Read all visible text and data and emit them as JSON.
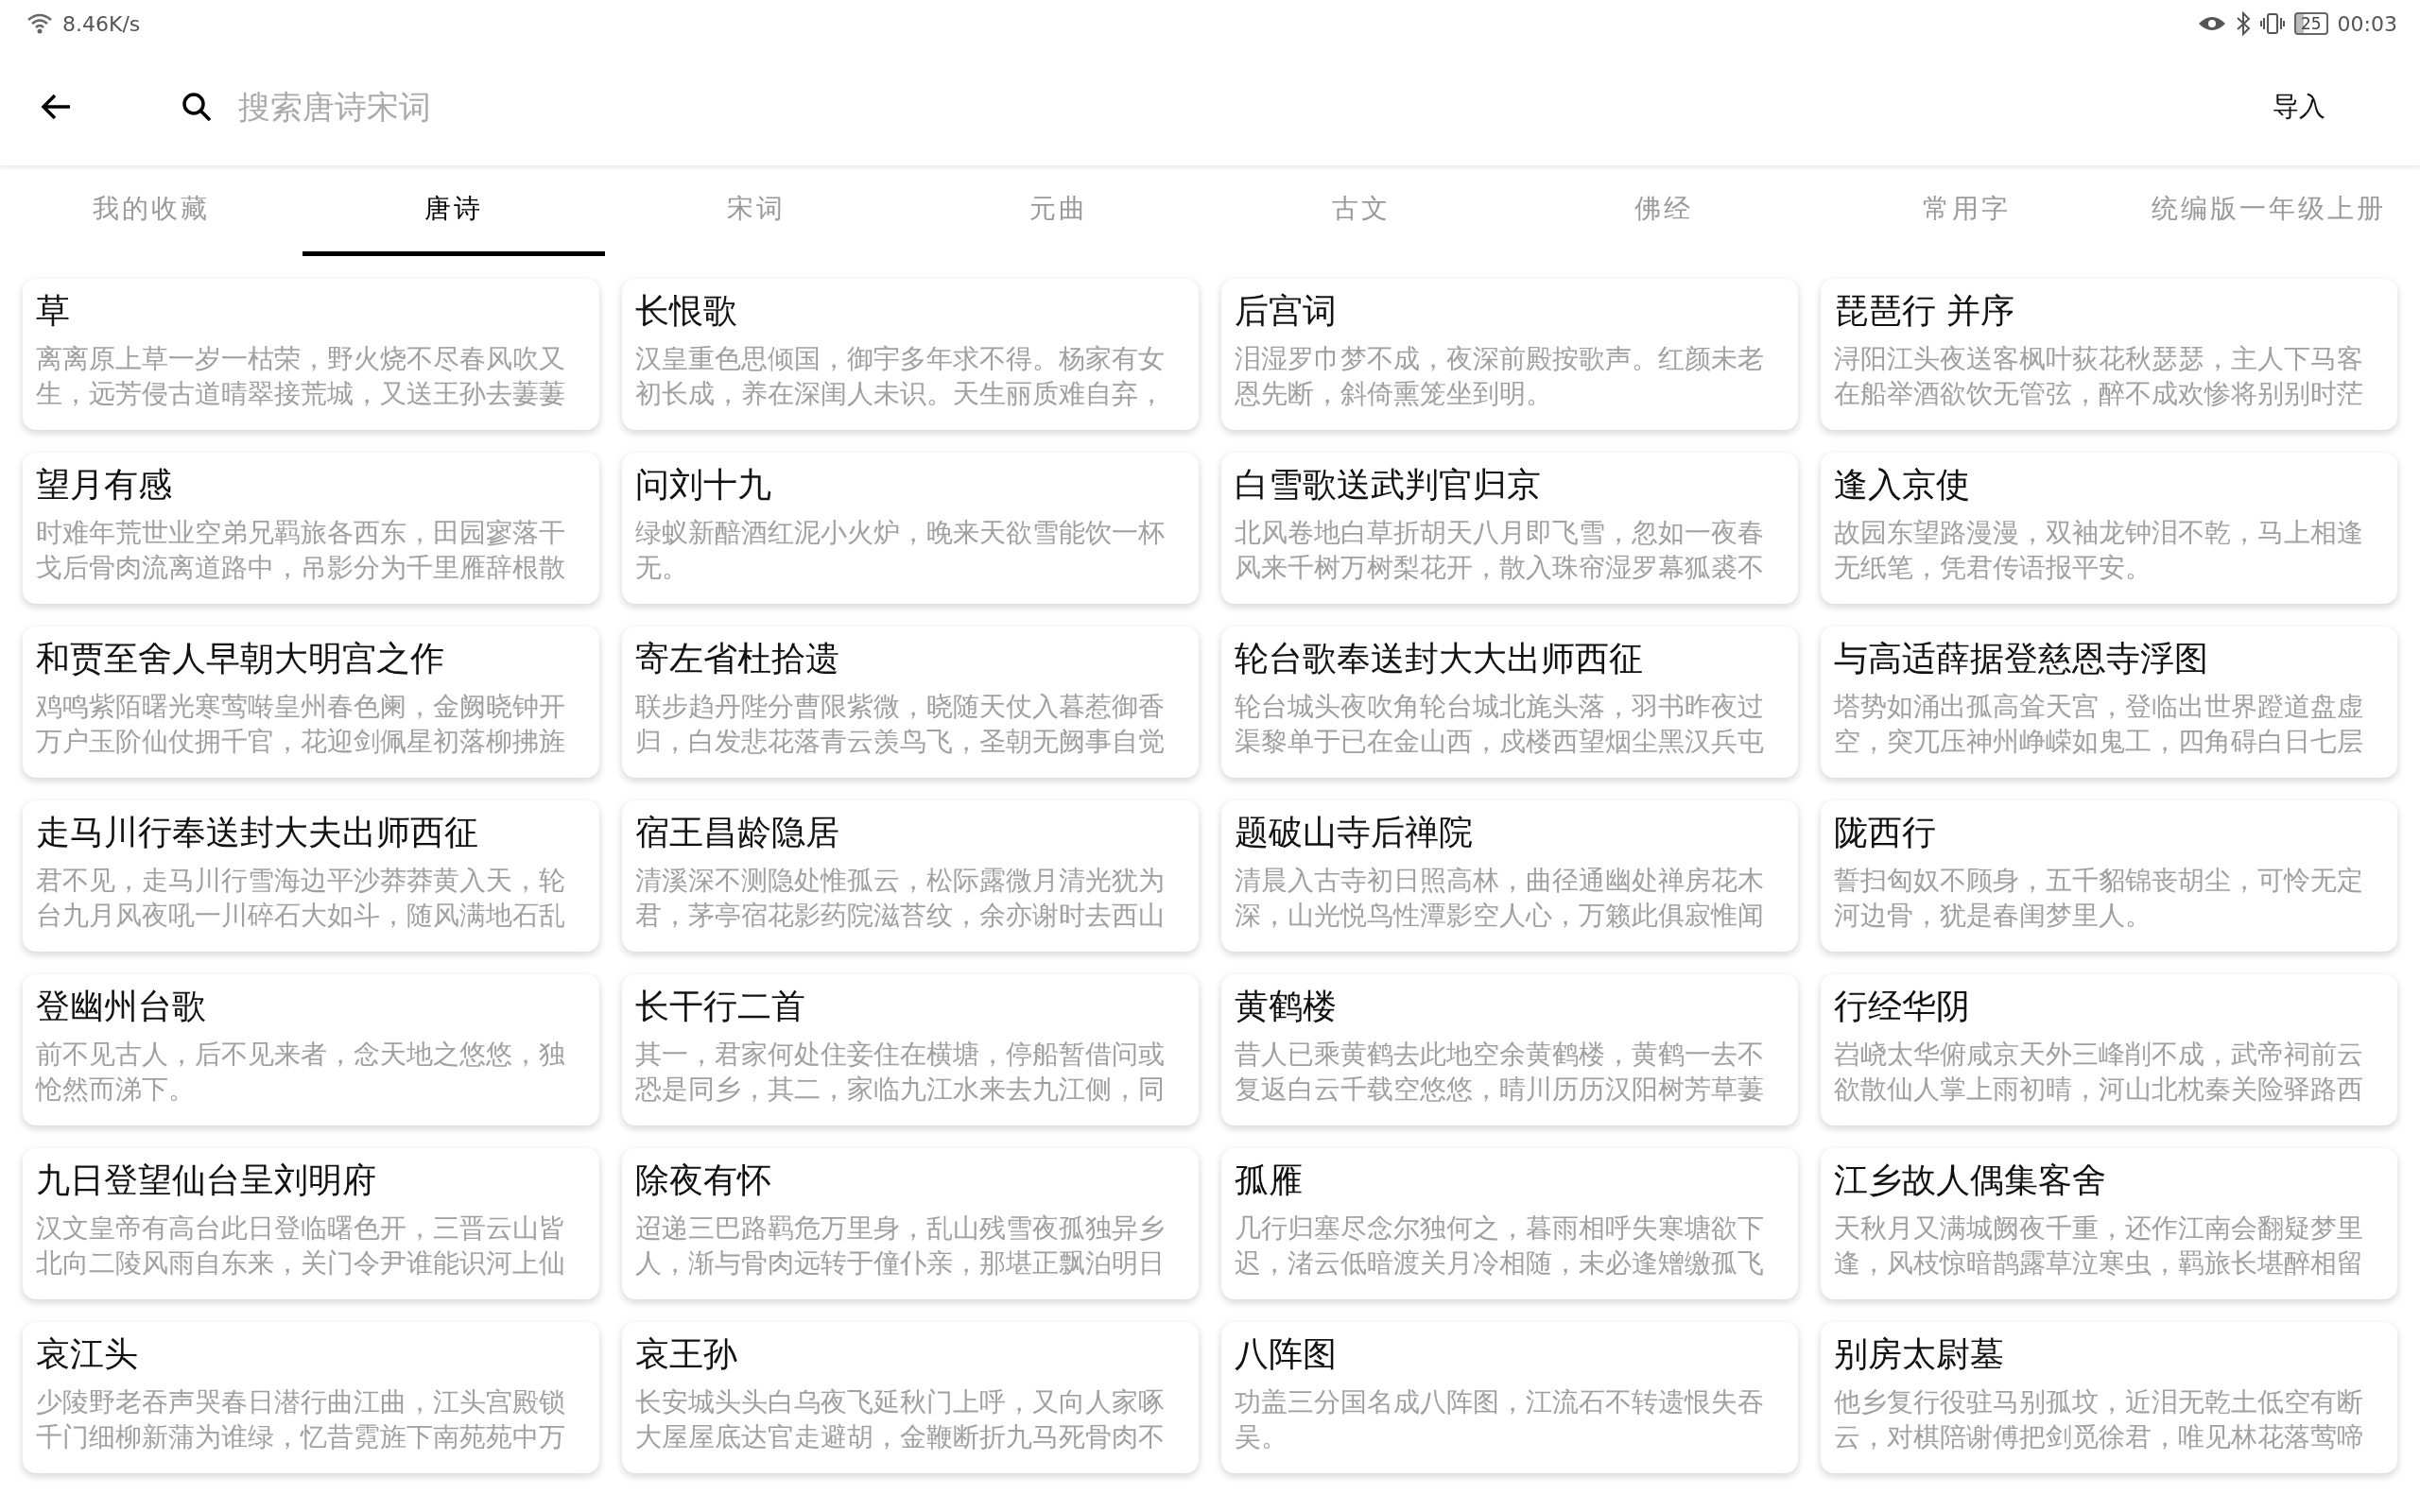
{
  "status_bar": {
    "speed": "8.46K/s",
    "battery": "25",
    "time": "00:03"
  },
  "header": {
    "search": {
      "placeholder": "搜索唐诗宋词"
    },
    "action": "导入"
  },
  "tabs": [
    {
      "label": "我的收藏",
      "selected": false
    },
    {
      "label": "唐诗",
      "selected": true
    },
    {
      "label": "宋词",
      "selected": false
    },
    {
      "label": "元曲",
      "selected": false
    },
    {
      "label": "古文",
      "selected": false
    },
    {
      "label": "佛经",
      "selected": false
    },
    {
      "label": "常用字",
      "selected": false
    },
    {
      "label": "统编版一年级上册",
      "selected": false
    }
  ],
  "poems": [
    {
      "title": "草",
      "excerpt": "离离原上草一岁一枯荣，野火烧不尽春风吹又生，远芳侵古道晴翠接荒城，又送王孙去萋萋"
    },
    {
      "title": "长恨歌",
      "excerpt": "汉皇重色思倾国，御宇多年求不得。杨家有女初长成，养在深闺人未识。天生丽质难自弃，"
    },
    {
      "title": "后宫词",
      "excerpt": "泪湿罗巾梦不成，夜深前殿按歌声。红颜未老恩先断，斜倚熏笼坐到明。"
    },
    {
      "title": "琵琶行 并序",
      "excerpt": "浔阳江头夜送客枫叶荻花秋瑟瑟，主人下马客在船举酒欲饮无管弦，醉不成欢惨将别别时茫"
    },
    {
      "title": "望月有感",
      "excerpt": "时难年荒世业空弟兄羁旅各西东，田园寥落干戈后骨肉流离道路中，吊影分为千里雁辞根散"
    },
    {
      "title": "问刘十九",
      "excerpt": "绿蚁新醅酒红泥小火炉，晚来天欲雪能饮一杯无。"
    },
    {
      "title": "白雪歌送武判官归京",
      "excerpt": "北风卷地白草折胡天八月即飞雪，忽如一夜春风来千树万树梨花开，散入珠帘湿罗幕狐裘不"
    },
    {
      "title": "逢入京使",
      "excerpt": "故园东望路漫漫，双袖龙钟泪不乾，马上相逢无纸笔，凭君传语报平安。"
    },
    {
      "title": "和贾至舍人早朝大明宫之作",
      "excerpt": "鸡鸣紫陌曙光寒莺啭皇州春色阑，金阙晓钟开万户玉阶仙仗拥千官，花迎剑佩星初落柳拂旌"
    },
    {
      "title": "寄左省杜拾遗",
      "excerpt": "联步趋丹陛分曹限紫微，晓随天仗入暮惹御香归，白发悲花落青云羡鸟飞，圣朝无阙事自觉"
    },
    {
      "title": "轮台歌奉送封大大出师西征",
      "excerpt": "轮台城头夜吹角轮台城北旄头落，羽书昨夜过渠黎单于已在金山西，戍楼西望烟尘黑汉兵屯"
    },
    {
      "title": "与高适薛据登慈恩寺浮图",
      "excerpt": "塔势如涌出孤高耸天宫，登临出世界蹬道盘虚空，突兀压神州峥嵘如鬼工，四角碍白日七层"
    },
    {
      "title": "走马川行奉送封大夫出师西征",
      "excerpt": "君不见，走马川行雪海边平沙莽莽黄入天，轮台九月风夜吼一川碎石大如斗，随风满地石乱"
    },
    {
      "title": "宿王昌龄隐居",
      "excerpt": "清溪深不测隐处惟孤云，松际露微月清光犹为君，茅亭宿花影药院滋苔纹，余亦谢时去西山"
    },
    {
      "title": "题破山寺后禅院",
      "excerpt": "清晨入古寺初日照高林，曲径通幽处禅房花木深，山光悦鸟性潭影空人心，万籁此俱寂惟闻"
    },
    {
      "title": "陇西行",
      "excerpt": "誓扫匈奴不顾身，五千貂锦丧胡尘，可怜无定河边骨，犹是春闺梦里人。"
    },
    {
      "title": "登幽州台歌",
      "excerpt": "前不见古人，后不见来者，念天地之悠悠，独怆然而涕下。"
    },
    {
      "title": "长干行二首",
      "excerpt": "其一，君家何处住妾住在横塘，停船暂借问或恐是同乡，其二，家临九江水来去九江侧，同"
    },
    {
      "title": "黄鹤楼",
      "excerpt": "昔人已乘黄鹤去此地空余黄鹤楼，黄鹤一去不复返白云千载空悠悠，晴川历历汉阳树芳草萋"
    },
    {
      "title": "行经华阴",
      "excerpt": "岧峣太华俯咸京天外三峰削不成，武帝祠前云欲散仙人掌上雨初晴，河山北枕秦关险驿路西"
    },
    {
      "title": "九日登望仙台呈刘明府",
      "excerpt": "汉文皇帝有高台此日登临曙色开，三晋云山皆北向二陵风雨自东来，关门令尹谁能识河上仙"
    },
    {
      "title": "除夜有怀",
      "excerpt": "迢递三巴路羁危万里身，乱山残雪夜孤独异乡人，渐与骨肉远转于僮仆亲，那堪正飘泊明日"
    },
    {
      "title": "孤雁",
      "excerpt": "几行归塞尽念尔独何之，暮雨相呼失寒塘欲下迟，渚云低暗渡关月冷相随，未必逢矰缴孤飞"
    },
    {
      "title": "江乡故人偶集客舍",
      "excerpt": "天秋月又满城阙夜千重，还作江南会翻疑梦里逢，风枝惊暗鹊露草泣寒虫，羁旅长堪醉相留"
    },
    {
      "title": "哀江头",
      "excerpt": "少陵野老吞声哭春日潜行曲江曲，江头宫殿锁千门细柳新蒲为谁绿，忆昔霓旌下南苑苑中万"
    },
    {
      "title": "哀王孙",
      "excerpt": "长安城头头白乌夜飞延秋门上呼，又向人家啄大屋屋底达官走避胡，金鞭断折九马死骨肉不"
    },
    {
      "title": "八阵图",
      "excerpt": "功盖三分国名成八阵图，江流石不转遗恨失吞吴。"
    },
    {
      "title": "别房太尉墓",
      "excerpt": "他乡复行役驻马别孤坟，近泪无乾土低空有断云，对棋陪谢傅把剑觅徐君，唯见林花落莺啼"
    }
  ]
}
